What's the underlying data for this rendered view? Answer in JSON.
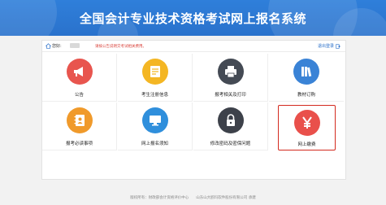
{
  "header": {
    "title": "全国会计专业技术资格考试网上报名系统"
  },
  "topbar": {
    "greeting": "您好:",
    "notice": "请按公告说明交考试相关费用。",
    "logout_label": "退出登录"
  },
  "tiles": [
    {
      "label": "公告",
      "icon": "megaphone-icon",
      "color": "#e8554e"
    },
    {
      "label": "考生注册信息",
      "icon": "registration-info-icon",
      "color": "#f4b623"
    },
    {
      "label": "报考相关及打印",
      "icon": "printer-icon",
      "color": "#444a54"
    },
    {
      "label": "教材订购",
      "icon": "books-icon",
      "color": "#3a83d6"
    },
    {
      "label": "报考必读事项",
      "icon": "contacts-book-icon",
      "color": "#f09a2b"
    },
    {
      "label": "网上报名须知",
      "icon": "monitor-icon",
      "color": "#2f8fdc"
    },
    {
      "label": "修改密码及密保问题",
      "icon": "lock-icon",
      "color": "#3d414a"
    },
    {
      "label": "网上缴费",
      "icon": "yuan-payment-icon",
      "color": "#e9504b"
    }
  ],
  "footer": {
    "text": "版权所有：财政部会计资格评价中心　　山东山大鸥玛软件股份有限公司 承建"
  }
}
